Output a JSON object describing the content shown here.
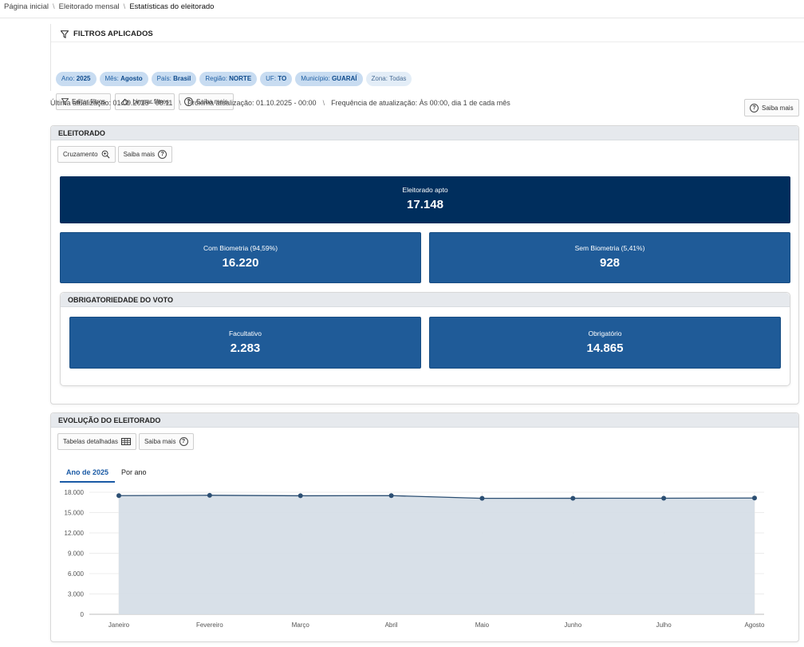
{
  "breadcrumb": [
    "Página inicial",
    "Eleitorado mensal",
    "Estatísticas do eleitorado"
  ],
  "filters": {
    "title": "FILTROS APLICADOS",
    "chips": [
      {
        "key": "Ano:",
        "value": "2025"
      },
      {
        "key": "Mês:",
        "value": "Agosto"
      },
      {
        "key": "País:",
        "value": "Brasil"
      },
      {
        "key": "Região:",
        "value": "NORTE"
      },
      {
        "key": "UF:",
        "value": "TO"
      },
      {
        "key": "Município:",
        "value": "GUARAÍ"
      },
      {
        "key": "Zona:",
        "value": "Todas"
      }
    ],
    "buttons": {
      "edit": "Editar filtros",
      "clear": "Limpar filtros",
      "help": "Saiba mais"
    }
  },
  "updates": {
    "last": "Última atualização: 01.09.2025 - 08:11",
    "next": "Próxima atualização: 01.10.2025 - 00:00",
    "frequency": "Frequência de atualização: Às 00:00, dia 1 de cada mês",
    "help": "Saiba mais"
  },
  "eleitorado": {
    "title": "ELEITORADO",
    "cruzamento": "Cruzamento",
    "help": "Saiba mais",
    "apto": {
      "label": "Eleitorado apto",
      "value": "17.148"
    },
    "com_biometria": {
      "label": "Com Biometria (94,59%)",
      "value": "16.220"
    },
    "sem_biometria": {
      "label": "Sem Biometria (5,41%)",
      "value": "928"
    },
    "obrigatoriedade": {
      "title": "OBRIGATORIEDADE DO VOTO",
      "facultativo": {
        "label": "Facultativo",
        "value": "2.283"
      },
      "obrigatorio": {
        "label": "Obrigatório",
        "value": "14.865"
      }
    }
  },
  "evolucao": {
    "title": "EVOLUÇÃO DO ELEITORADO",
    "tabelas": "Tabelas detalhadas",
    "help": "Saiba mais",
    "tabs": [
      "Ano de 2025",
      "Por ano"
    ]
  },
  "colors": {
    "dark_card": "#002e5d",
    "mid_card": "#1f5b98",
    "line": "#2c4f73",
    "area": "#d6dee7",
    "accent": "#1a5aa5"
  },
  "chart_data": {
    "type": "area",
    "categories": [
      "Janeiro",
      "Fevereiro",
      "Março",
      "Abril",
      "Maio",
      "Junho",
      "Julho",
      "Agosto"
    ],
    "series": [
      {
        "values": [
          17500,
          17550,
          17480,
          17500,
          17100,
          17110,
          17120,
          17148
        ]
      }
    ],
    "yticks": [
      "0",
      "3.000",
      "6.000",
      "9.000",
      "12.000",
      "15.000",
      "18.000"
    ],
    "ylim": [
      0,
      18000
    ],
    "grid": true
  }
}
